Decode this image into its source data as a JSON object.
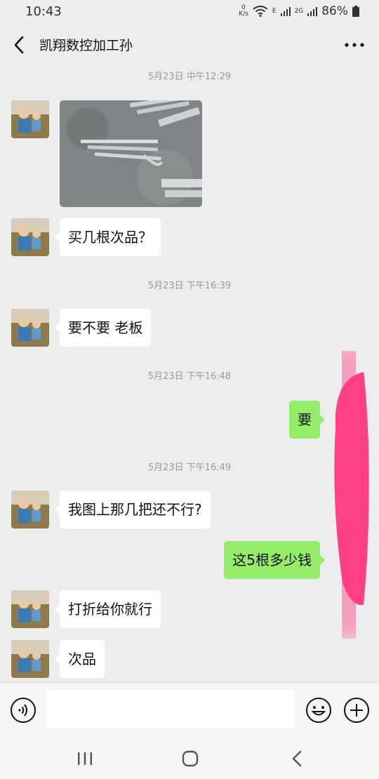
{
  "status": {
    "time": "10:43",
    "speed_value": "0",
    "speed_unit": "K/s",
    "network_e": "E",
    "network_2g": "2G",
    "battery": "86%"
  },
  "header": {
    "title": "凯翔数控加工孙"
  },
  "timestamps": [
    "5月23日 中午12:29",
    "5月23日 下午16:39",
    "5月23日 下午16:48",
    "5月23日 下午16:49"
  ],
  "messages": [
    {
      "from": "contact",
      "type": "image"
    },
    {
      "from": "contact",
      "text": "买几根次品？"
    },
    {
      "from": "contact",
      "text": "要不要 老板"
    },
    {
      "from": "me",
      "text": "要"
    },
    {
      "from": "contact",
      "text": "我图上那几把还不行?"
    },
    {
      "from": "me",
      "text": "这5根多少钱"
    },
    {
      "from": "contact",
      "text": "打折给你就行"
    },
    {
      "from": "contact",
      "text": "次品"
    }
  ],
  "input": {
    "value": ""
  },
  "icons": {
    "back": "chevron-left-icon",
    "more": "more-dots-icon",
    "voice": "voice-icon",
    "emoji": "emoji-icon",
    "plus": "plus-icon",
    "nav_recent": "recent-apps-icon",
    "nav_home": "home-icon",
    "nav_back": "nav-back-icon"
  },
  "colors": {
    "background": "#ededed",
    "incoming_bubble": "#ffffff",
    "outgoing_bubble": "#95ec69",
    "scribble": "#ff3f86",
    "timestamp": "#9a9a9a"
  }
}
